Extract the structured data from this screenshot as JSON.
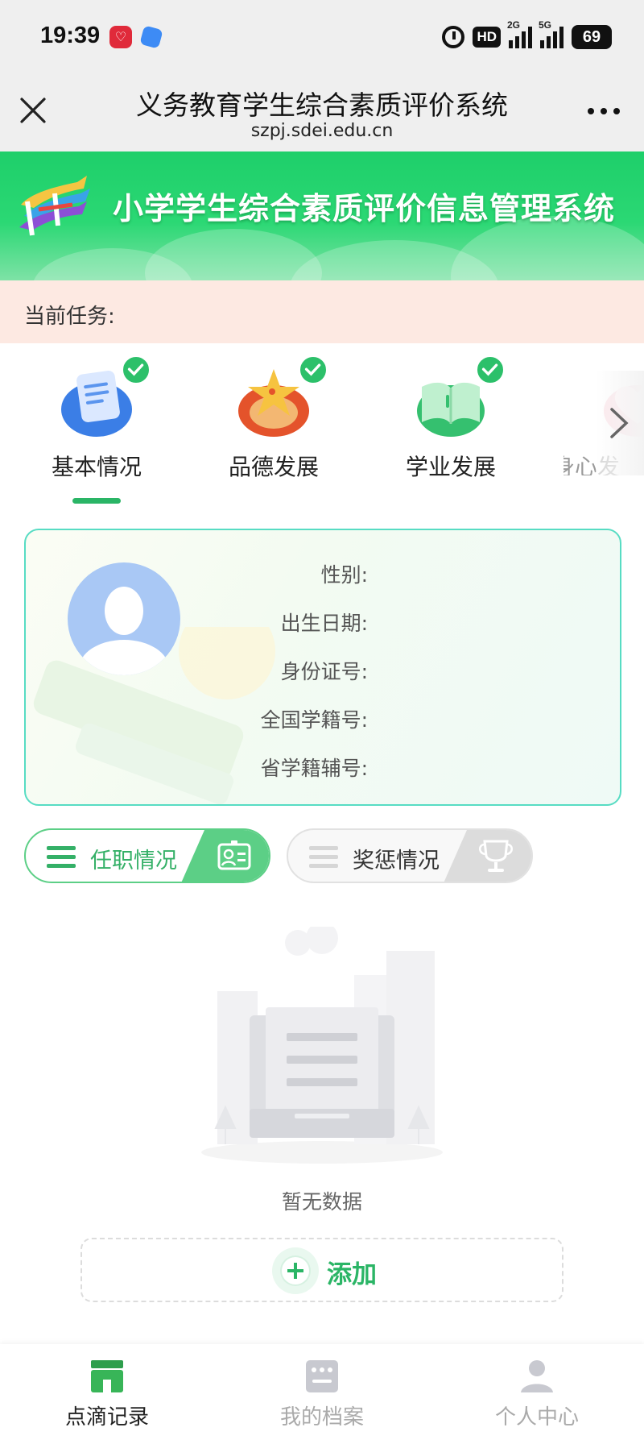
{
  "status_bar": {
    "time": "19:39",
    "network_hd": "HD",
    "sig1_label": "2G",
    "sig2_label": "5G",
    "battery": "69"
  },
  "title_bar": {
    "title": "义务教育学生综合素质评价系统",
    "url": "szpj.sdei.edu.cn"
  },
  "banner": {
    "title": "小学学生综合素质评价信息管理系统"
  },
  "task": {
    "label": "当前任务:"
  },
  "categories": [
    {
      "label": "基本情况",
      "icon": "document-icon",
      "checked": true,
      "active": true
    },
    {
      "label": "品德发展",
      "icon": "star-icon",
      "checked": true
    },
    {
      "label": "学业发展",
      "icon": "book-icon",
      "checked": true
    },
    {
      "label": "身心发",
      "icon": "heart-icon",
      "checked": false
    }
  ],
  "profile": {
    "fields": [
      {
        "label": "性别:"
      },
      {
        "label": "出生日期:"
      },
      {
        "label": "身份证号:"
      },
      {
        "label": "全国学籍号:"
      },
      {
        "label": "省学籍辅号:"
      }
    ]
  },
  "toggles": {
    "position": "任职情况",
    "awards": "奖惩情况"
  },
  "empty": {
    "text": "暂无数据",
    "add_label": "添加"
  },
  "bottom_nav": {
    "items": [
      {
        "label": "点滴记录",
        "active": true
      },
      {
        "label": "我的档案",
        "active": false
      },
      {
        "label": "个人中心",
        "active": false
      }
    ]
  },
  "colors": {
    "brand_green": "#2bb566",
    "banner_green": "#1ecf6a",
    "task_bg": "#fde9e2",
    "card_border": "#57dcc3"
  }
}
